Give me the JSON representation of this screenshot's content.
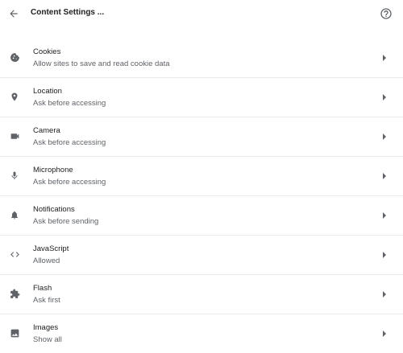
{
  "header": {
    "title": "Content Settings ..."
  },
  "settings": [
    {
      "label": "Cookies",
      "sub": "Allow sites to save and read cookie data",
      "icon": "cookie-icon"
    },
    {
      "label": "Location",
      "sub": "Ask before accessing",
      "icon": "location-pin-icon"
    },
    {
      "label": "Camera",
      "sub": "Ask before accessing",
      "icon": "camera-icon"
    },
    {
      "label": "Microphone",
      "sub": "Ask before accessing",
      "icon": "microphone-icon"
    },
    {
      "label": "Notifications",
      "sub": "Ask before sending",
      "icon": "bell-icon"
    },
    {
      "label": "JavaScript",
      "sub": "Allowed",
      "icon": "code-icon"
    },
    {
      "label": "Flash",
      "sub": "Ask first",
      "icon": "puzzle-icon"
    },
    {
      "label": "Images",
      "sub": "Show all",
      "icon": "image-icon"
    }
  ],
  "colors": {
    "icon": "#5f6368",
    "divider": "#e8eaed",
    "text": "#202124",
    "subtext": "#5f6368"
  }
}
